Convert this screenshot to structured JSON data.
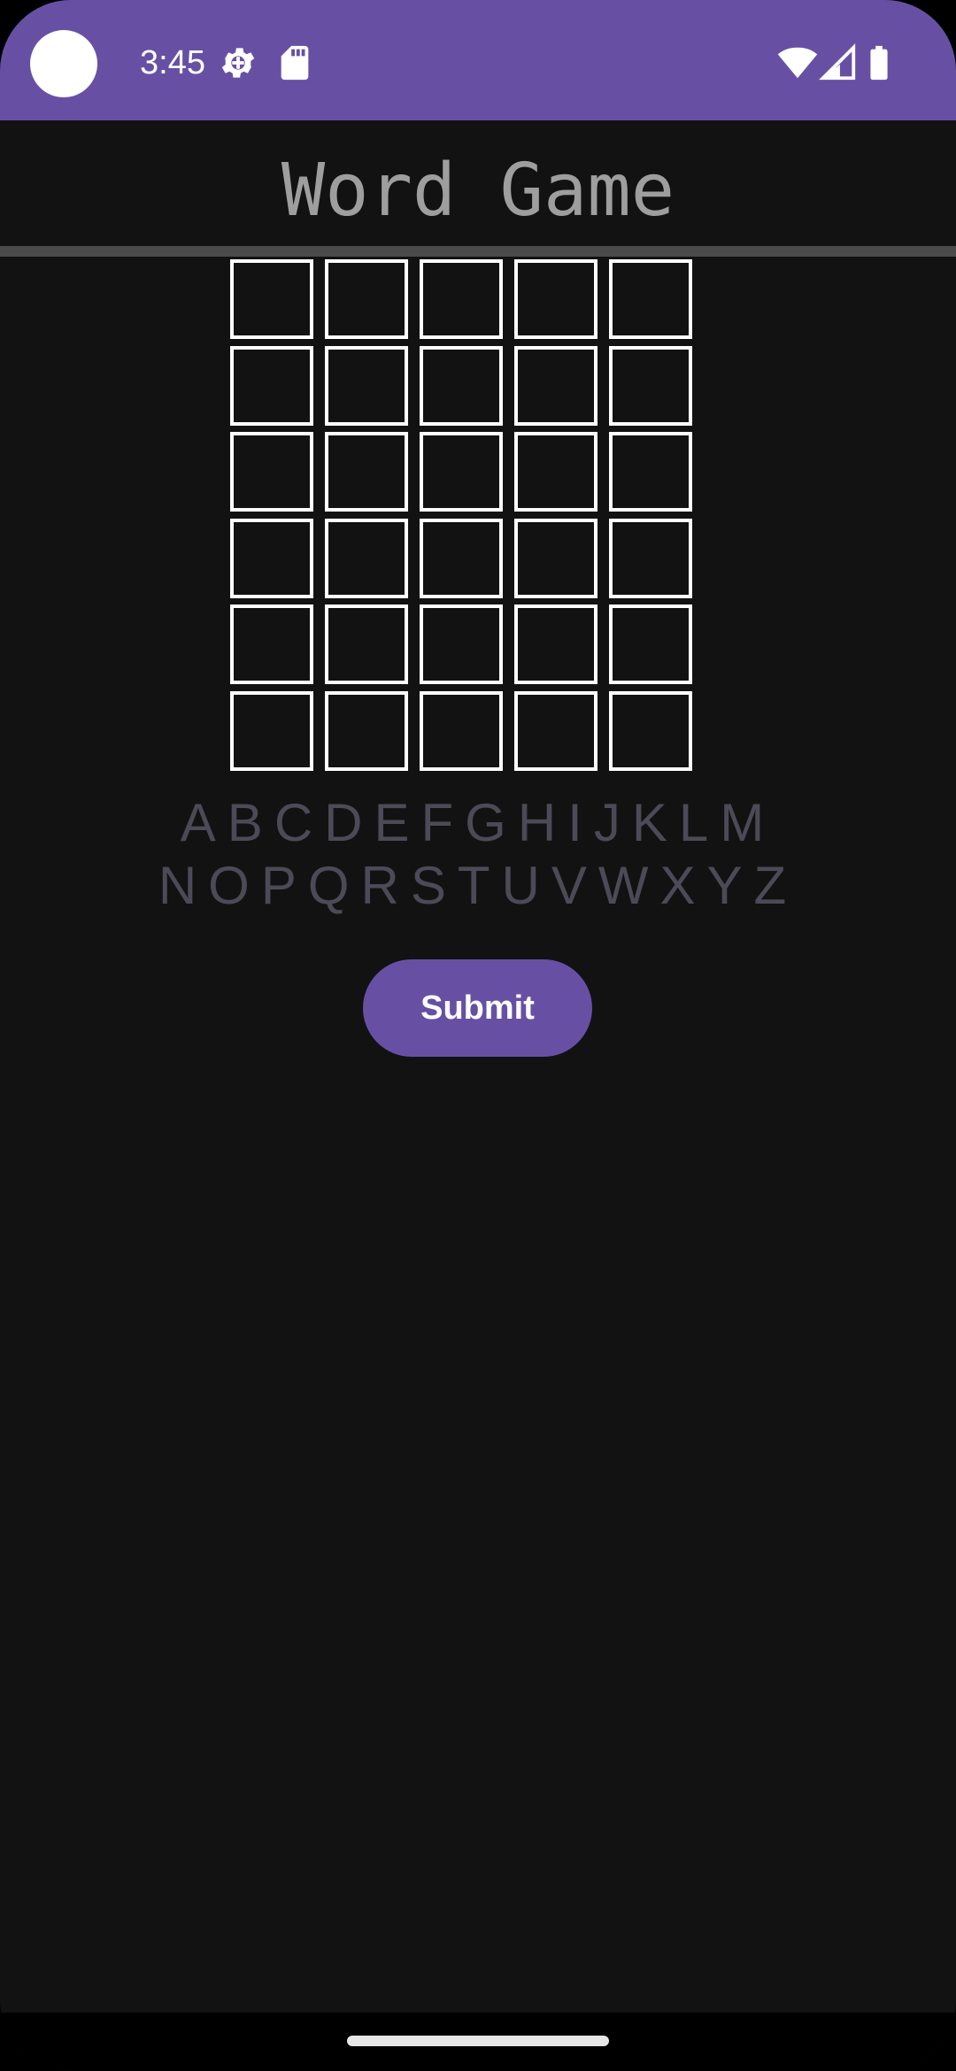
{
  "status_bar": {
    "time": "3:45",
    "icons": [
      "camera-cutout",
      "settings-gear-icon",
      "sd-card-icon",
      "wifi-icon",
      "cellular-signal-icon",
      "battery-icon"
    ],
    "background_color": "#6750A4"
  },
  "app_bar": {
    "title": "Word Game"
  },
  "grid": {
    "rows": 6,
    "columns": 5,
    "cells": [
      [
        "",
        "",
        "",
        "",
        ""
      ],
      [
        "",
        "",
        "",
        "",
        ""
      ],
      [
        "",
        "",
        "",
        "",
        ""
      ],
      [
        "",
        "",
        "",
        "",
        ""
      ],
      [
        "",
        "",
        "",
        "",
        ""
      ],
      [
        "",
        "",
        "",
        "",
        ""
      ]
    ]
  },
  "letters": {
    "row_1": "ABCDEFGHIJKLM",
    "row_2": "NOPQRSTUVWXYZ",
    "color": "#4B4A56"
  },
  "submit": {
    "label": "Submit",
    "color": "#6750A4"
  }
}
